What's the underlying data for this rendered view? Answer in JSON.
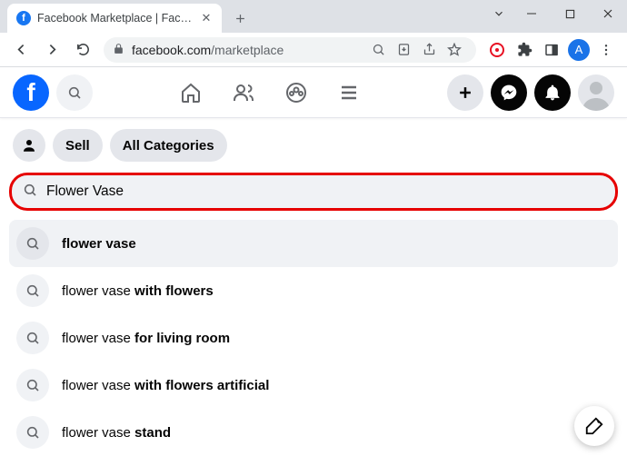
{
  "browser": {
    "tab_title": "Facebook Marketplace | Facebook",
    "url_host": "facebook.com",
    "url_path": "/marketplace",
    "profile_letter": "A"
  },
  "filters": {
    "sell": "Sell",
    "categories": "All Categories"
  },
  "search": {
    "value": "Flower Vase"
  },
  "suggestions": [
    {
      "prefix": "",
      "match": "flower vase",
      "suffix": ""
    },
    {
      "prefix": "flower vase ",
      "match": "with flowers",
      "suffix": ""
    },
    {
      "prefix": "flower vase ",
      "match": "for living room",
      "suffix": ""
    },
    {
      "prefix": "flower vase ",
      "match": "with flowers artificial",
      "suffix": ""
    },
    {
      "prefix": "flower vase ",
      "match": "stand",
      "suffix": ""
    }
  ]
}
